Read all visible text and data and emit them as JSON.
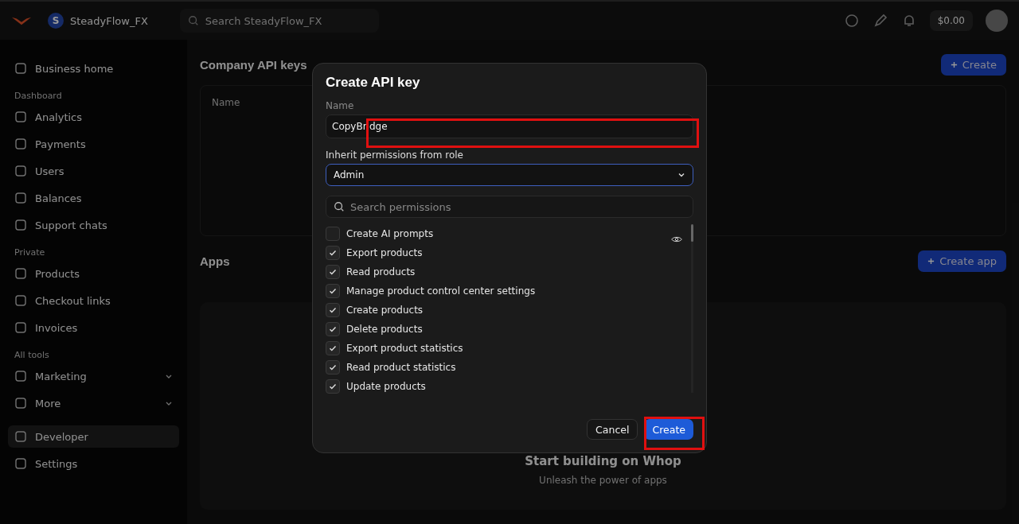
{
  "topbar": {
    "workspace": "SteadyFlow_FX",
    "workspace_initial": "S",
    "search": {
      "placeholder": "Search SteadyFlow_FX"
    },
    "balance": "$0.00"
  },
  "sidebar": {
    "sections": [
      {
        "items": [
          {
            "label": "Business home",
            "selected": false,
            "expandable": false
          }
        ]
      },
      {
        "heading": "Dashboard",
        "items": [
          {
            "label": "Analytics",
            "selected": false,
            "expandable": false
          },
          {
            "label": "Payments",
            "selected": false,
            "expandable": false
          },
          {
            "label": "Users",
            "selected": false,
            "expandable": false
          },
          {
            "label": "Balances",
            "selected": false,
            "expandable": false
          },
          {
            "label": "Support chats",
            "selected": false,
            "expandable": false
          }
        ]
      },
      {
        "heading": "Private",
        "items": [
          {
            "label": "Products",
            "selected": false,
            "expandable": false
          },
          {
            "label": "Checkout links",
            "selected": false,
            "expandable": false
          },
          {
            "label": "Invoices",
            "selected": false,
            "expandable": false
          }
        ]
      },
      {
        "heading": "All tools",
        "items": [
          {
            "label": "Marketing",
            "selected": false,
            "expandable": true
          },
          {
            "label": "More",
            "selected": false,
            "expandable": true
          }
        ]
      },
      {
        "items": [
          {
            "label": "Developer",
            "selected": true,
            "expandable": false
          },
          {
            "label": "Settings",
            "selected": false,
            "expandable": false
          }
        ]
      }
    ]
  },
  "main": {
    "api_keys": {
      "title": "Company API keys",
      "button": "Create",
      "column": "Name"
    },
    "apps": {
      "title": "Apps",
      "button": "Create app",
      "empty_title": "Start building on Whop",
      "empty_subtitle": "Unleash the power of apps"
    }
  },
  "dialog": {
    "title": "Create API key",
    "name_label": "Name",
    "name_value": "CopyBridge",
    "role_label": "Inherit permissions from role",
    "role_value": "Admin",
    "search": {
      "placeholder": "Search permissions"
    },
    "permissions": [
      {
        "label": "Create AI prompts",
        "checked": false
      },
      {
        "label": "Export products",
        "checked": true
      },
      {
        "label": "Read products",
        "checked": true
      },
      {
        "label": "Manage product control center settings",
        "checked": true
      },
      {
        "label": "Create products",
        "checked": true
      },
      {
        "label": "Delete products",
        "checked": true
      },
      {
        "label": "Export product statistics",
        "checked": true
      },
      {
        "label": "Read product statistics",
        "checked": true
      },
      {
        "label": "Update products",
        "checked": true
      }
    ],
    "buttons": [
      {
        "label": "Cancel",
        "kind": "secondary"
      },
      {
        "label": "Create",
        "kind": "primary"
      }
    ]
  }
}
